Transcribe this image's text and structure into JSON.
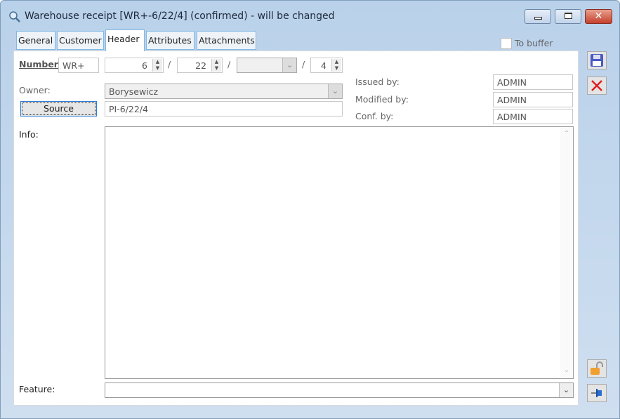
{
  "window": {
    "title": "Warehouse receipt [WR+-6/22/4] (confirmed) - will be changed"
  },
  "tabs": [
    {
      "label": "General"
    },
    {
      "label": "Customer"
    },
    {
      "label": "Header"
    },
    {
      "label": "Attributes"
    },
    {
      "label": "Attachments"
    }
  ],
  "to_buffer": {
    "label": "To buffer",
    "checked": false
  },
  "number": {
    "label": "Number",
    "series": "WR+",
    "part1": "6",
    "part2": "22",
    "part3": "",
    "part4": "4"
  },
  "owner": {
    "label": "Owner:",
    "value": "Borysewicz"
  },
  "source": {
    "button_label": "Source",
    "value": "PI-6/22/4"
  },
  "issued_by": {
    "label": "Issued by:",
    "value": "ADMIN"
  },
  "modified_by": {
    "label": "Modified by:",
    "value": "ADMIN"
  },
  "conf_by": {
    "label": "Conf. by:",
    "value": "ADMIN"
  },
  "info": {
    "label": "Info:",
    "value": ""
  },
  "feature": {
    "label": "Feature:",
    "value": ""
  },
  "icons": {
    "save": "save-icon",
    "cancel": "close-icon",
    "lock": "unlock-icon",
    "pin": "pin-icon"
  }
}
